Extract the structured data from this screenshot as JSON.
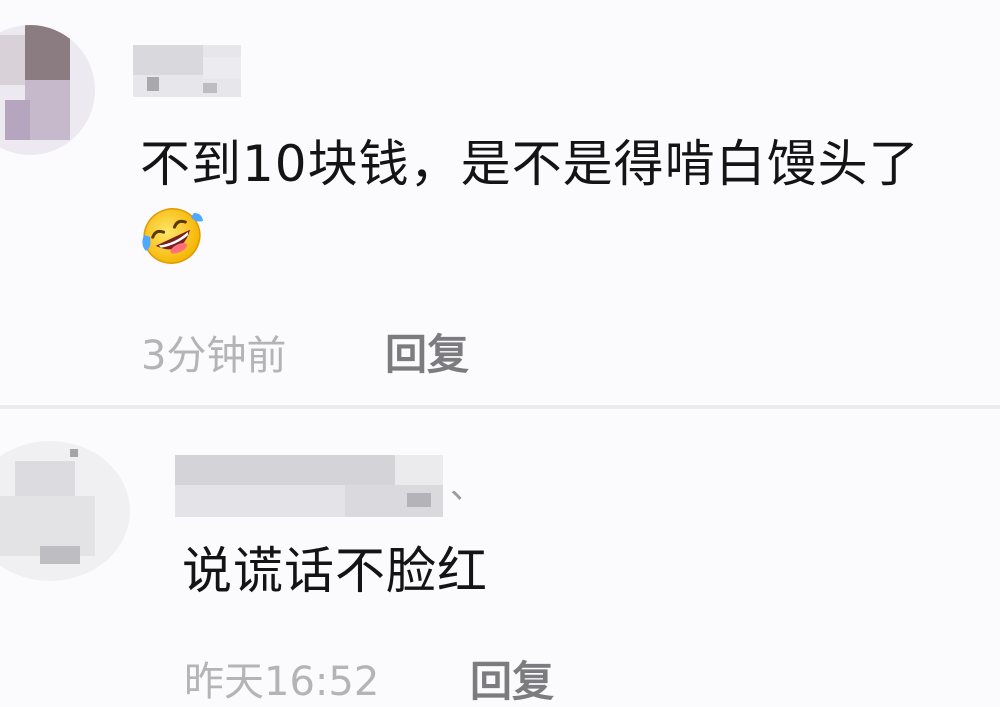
{
  "comments": [
    {
      "text": "不到10块钱，是不是得啃白馒头了",
      "emoji": "rofl-emoji",
      "time": "3分钟前",
      "reply_label": "回复"
    },
    {
      "username_suffix": "、",
      "text": "说谎话不脸红",
      "time": "昨天16:52",
      "reply_label": "回复"
    }
  ],
  "colors": {
    "background": "#fbfbfd",
    "text": "#141414",
    "meta": "#b4b4b8",
    "reply": "#7c7c80",
    "divider": "#ececf0"
  }
}
